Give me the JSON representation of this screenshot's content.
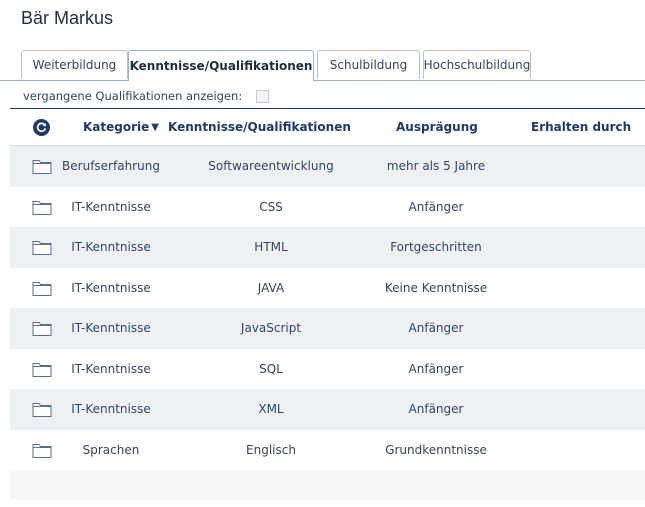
{
  "page": {
    "title": "Bär Markus"
  },
  "tabs": [
    {
      "label": "Weiterbildung",
      "active": false
    },
    {
      "label": "Kenntnisse/Qualifikationen",
      "active": true
    },
    {
      "label": "Schulbildung",
      "active": false
    },
    {
      "label": "Hochschulbildung",
      "active": false
    }
  ],
  "filter": {
    "label": "vergangene Qualifikationen anzeigen:",
    "checked": false
  },
  "table": {
    "columns": {
      "kategorie": "Kategorie",
      "kenntnisse": "Kenntnisse/Qualifikationen",
      "auspraegung": "Ausprägung",
      "erhalten": "Erhalten durch"
    },
    "sort_indicator": "▼",
    "rows": [
      {
        "kategorie": "Berufserfahrung",
        "kenntnis": "Softwareentwicklung",
        "auspraegung": "mehr als 5 Jahre",
        "erhalten": ""
      },
      {
        "kategorie": "IT-Kenntnisse",
        "kenntnis": "CSS",
        "auspraegung": "Anfänger",
        "erhalten": ""
      },
      {
        "kategorie": "IT-Kenntnisse",
        "kenntnis": "HTML",
        "auspraegung": "Fortgeschritten",
        "erhalten": ""
      },
      {
        "kategorie": "IT-Kenntnisse",
        "kenntnis": "JAVA",
        "auspraegung": "Keine Kenntnisse",
        "erhalten": ""
      },
      {
        "kategorie": "IT-Kenntnisse",
        "kenntnis": "JavaScript",
        "auspraegung": "Anfänger",
        "erhalten": ""
      },
      {
        "kategorie": "IT-Kenntnisse",
        "kenntnis": "SQL",
        "auspraegung": "Anfänger",
        "erhalten": ""
      },
      {
        "kategorie": "IT-Kenntnisse",
        "kenntnis": "XML",
        "auspraegung": "Anfänger",
        "erhalten": ""
      },
      {
        "kategorie": "Sprachen",
        "kenntnis": "Englisch",
        "auspraegung": "Grundkenntnisse",
        "erhalten": ""
      }
    ]
  },
  "icons": {
    "refresh": "refresh-icon",
    "folder": "folder-icon"
  },
  "colors": {
    "accent": "#1f3a66",
    "row_alt": "#eef1f4"
  }
}
